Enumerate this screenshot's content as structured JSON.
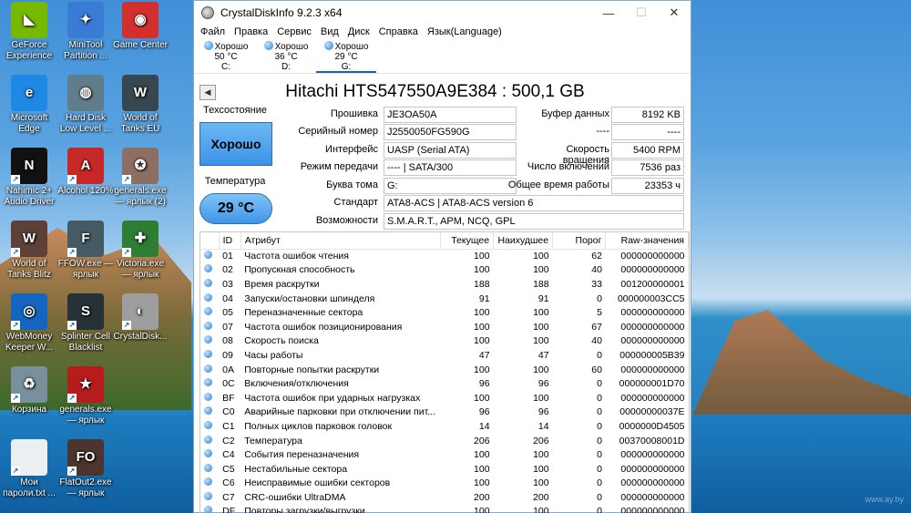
{
  "desktop": {
    "icons": [
      {
        "label": "GeForce Experience",
        "color": "#76b900",
        "glyph": "◣"
      },
      {
        "label": "MiniTool Partition ...",
        "color": "#3a7bd5",
        "glyph": "✦"
      },
      {
        "label": "Game Center",
        "color": "#d32f2f",
        "glyph": "◉"
      },
      {
        "label": "Microsoft Edge",
        "color": "#1e88e5",
        "glyph": "e"
      },
      {
        "label": "Hard Disk Low Level ...",
        "color": "#607d8b",
        "glyph": "◍"
      },
      {
        "label": "World of Tanks EU",
        "color": "#37474f",
        "glyph": "W"
      },
      {
        "label": "Nahimic 2+ Audio Driver",
        "color": "#111111",
        "glyph": "N"
      },
      {
        "label": "Alcohol 120%",
        "color": "#c62828",
        "glyph": "A"
      },
      {
        "label": "generals.exe — ярлык (2)",
        "color": "#8d6e63",
        "glyph": "✪"
      },
      {
        "label": "World of Tanks Blitz",
        "color": "#5d4037",
        "glyph": "W"
      },
      {
        "label": "FFOW.exe — ярлык",
        "color": "#455a64",
        "glyph": "F"
      },
      {
        "label": "Victoria.exe — ярлык",
        "color": "#2e7d32",
        "glyph": "✚"
      },
      {
        "label": "WebMoney Keeper W...",
        "color": "#1565c0",
        "glyph": "◎"
      },
      {
        "label": "Splinter Cell Blacklist",
        "color": "#263238",
        "glyph": "S"
      },
      {
        "label": "CrystalDisk...",
        "color": "#9e9e9e",
        "glyph": "◐"
      },
      {
        "label": "Корзина",
        "color": "#78909c",
        "glyph": "♻"
      },
      {
        "label": "generals.exe — ярлык",
        "color": "#b71c1c",
        "glyph": "★"
      },
      {
        "label": "Мои пароли.txt ...",
        "color": "#eceff1",
        "glyph": ""
      },
      {
        "label": "FlatOut2.exe — ярлык",
        "color": "#4e342e",
        "glyph": "FO"
      }
    ],
    "watermark": "www.ay.by"
  },
  "window": {
    "title": "CrystalDiskInfo 9.2.3 x64",
    "controls": {
      "minimize": "—",
      "maximize": "☐",
      "close": "✕"
    },
    "menu": [
      "Файл",
      "Правка",
      "Сервис",
      "Вид",
      "Диск",
      "Справка",
      "Язык(Language)"
    ],
    "drives": [
      {
        "status": "Хорошо",
        "temp": "50 °C",
        "letter": "C:"
      },
      {
        "status": "Хорошо",
        "temp": "36 °C",
        "letter": "D:"
      },
      {
        "status": "Хорошо",
        "temp": "29 °C",
        "letter": "G:"
      }
    ],
    "model": "Hitachi HTS547550A9E384 : 500,1 GB",
    "health_label": "Техсостояние",
    "health_value": "Хорошо",
    "temp_label": "Температура",
    "temp_value": "29 °C",
    "fields_left": [
      {
        "label": "Прошивка",
        "value": "JE3OA50A"
      },
      {
        "label": "Серийный номер",
        "value": "J2550050FG590G"
      },
      {
        "label": "Интерфейс",
        "value": "UASP (Serial ATA)"
      },
      {
        "label": "Режим передачи",
        "value": "---- | SATA/300"
      },
      {
        "label": "Буква тома",
        "value": "G:"
      }
    ],
    "fields_right": [
      {
        "label": "Буфер данных",
        "value": "8192 KB"
      },
      {
        "label": "----",
        "value": "----"
      },
      {
        "label": "Скорость вращения",
        "value": "5400 RPM"
      },
      {
        "label": "Число включений",
        "value": "7536 раз"
      },
      {
        "label": "Общее время работы",
        "value": "23353 ч"
      }
    ],
    "standard_label": "Стандарт",
    "standard_value": "ATA8-ACS | ATA8-ACS version 6",
    "features_label": "Возможности",
    "features_value": "S.M.A.R.T., APM, NCQ, GPL",
    "table": {
      "headers": [
        "",
        "ID",
        "Атрибут",
        "Текущее",
        "Наихудшее",
        "Порог",
        "Raw-значения"
      ],
      "rows": [
        [
          "01",
          "Частота ошибок чтения",
          "100",
          "100",
          "62",
          "000000000000"
        ],
        [
          "02",
          "Пропускная способность",
          "100",
          "100",
          "40",
          "000000000000"
        ],
        [
          "03",
          "Время раскрутки",
          "188",
          "188",
          "33",
          "001200000001"
        ],
        [
          "04",
          "Запуски/остановки шпинделя",
          "91",
          "91",
          "0",
          "000000003CC5"
        ],
        [
          "05",
          "Переназначенные сектора",
          "100",
          "100",
          "5",
          "000000000000"
        ],
        [
          "07",
          "Частота ошибок позиционирования",
          "100",
          "100",
          "67",
          "000000000000"
        ],
        [
          "08",
          "Скорость поиска",
          "100",
          "100",
          "40",
          "000000000000"
        ],
        [
          "09",
          "Часы работы",
          "47",
          "47",
          "0",
          "000000005B39"
        ],
        [
          "0A",
          "Повторные попытки раскрутки",
          "100",
          "100",
          "60",
          "000000000000"
        ],
        [
          "0C",
          "Включения/отключения",
          "96",
          "96",
          "0",
          "000000001D70"
        ],
        [
          "BF",
          "Частота ошибок при ударных нагрузках",
          "100",
          "100",
          "0",
          "000000000000"
        ],
        [
          "C0",
          "Аварийные парковки при отключении пит...",
          "96",
          "96",
          "0",
          "00000000037E"
        ],
        [
          "C1",
          "Полных циклов парковок головок",
          "14",
          "14",
          "0",
          "0000000D4505"
        ],
        [
          "C2",
          "Температура",
          "206",
          "206",
          "0",
          "00370008001D"
        ],
        [
          "C4",
          "События переназначения",
          "100",
          "100",
          "0",
          "000000000000"
        ],
        [
          "C5",
          "Нестабильные сектора",
          "100",
          "100",
          "0",
          "000000000000"
        ],
        [
          "C6",
          "Неисправимые ошибки секторов",
          "100",
          "100",
          "0",
          "000000000000"
        ],
        [
          "C7",
          "CRC-ошибки UltraDMA",
          "200",
          "200",
          "0",
          "000000000000"
        ],
        [
          "DF",
          "Повторы загрузки/выгрузки",
          "100",
          "100",
          "0",
          "000000000000"
        ]
      ]
    }
  }
}
